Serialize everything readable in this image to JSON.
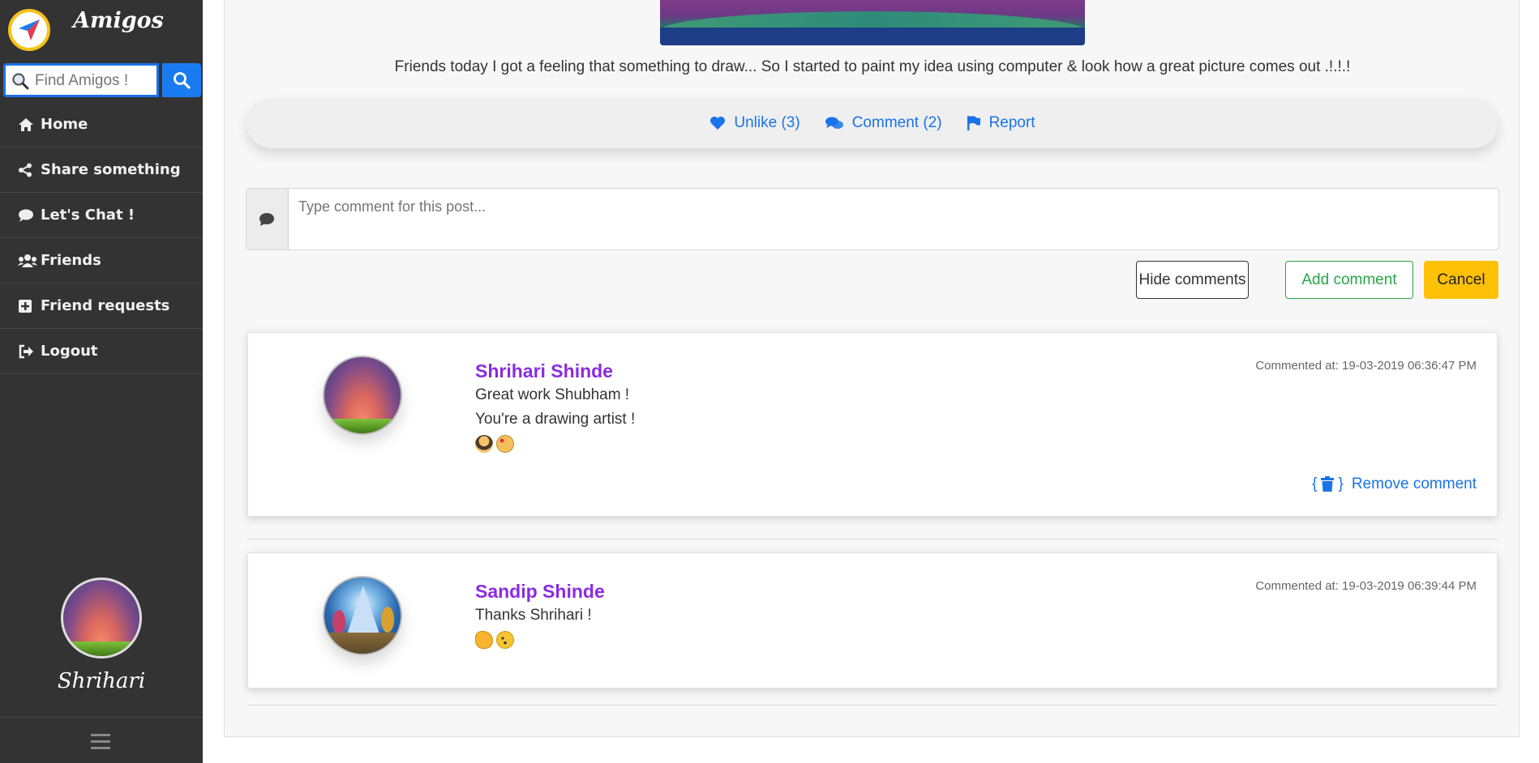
{
  "app": {
    "brand": "Amigos"
  },
  "search": {
    "placeholder": "Find Amigos !"
  },
  "nav": {
    "items": [
      {
        "label": "Home",
        "icon": "home-icon"
      },
      {
        "label": "Share something",
        "icon": "share-icon"
      },
      {
        "label": "Let's Chat !",
        "icon": "chat-icon"
      },
      {
        "label": "Friends",
        "icon": "users-icon"
      },
      {
        "label": "Friend requests",
        "icon": "plus-square-icon"
      },
      {
        "label": "Logout",
        "icon": "sign-out-icon"
      }
    ]
  },
  "user": {
    "name": "Shrihari"
  },
  "post": {
    "caption": "Friends today I got a feeling that something to draw... So I started to paint my idea using computer & look how a great picture comes out .!.!.!",
    "actions": {
      "unlike": "Unlike (3)",
      "comment": "Comment (2)",
      "report": "Report"
    }
  },
  "comment_form": {
    "placeholder": "Type comment for this post...",
    "hide_label": "Hide comments",
    "add_label": "Add comment",
    "cancel_label": "Cancel"
  },
  "comments": [
    {
      "author": "Shrihari Shinde",
      "time": "Commented at: 19-03-2019 06:36:47 PM",
      "lines": [
        "Great work Shubham !",
        "You're a drawing artist !"
      ],
      "emojis": [
        "artist-emoji",
        "palette-emoji"
      ],
      "remove_label": "Remove comment",
      "remove_prefix": "{",
      "remove_suffix": "}"
    },
    {
      "author": "Sandip Shinde",
      "time": "Commented at: 19-03-2019 06:39:44 PM",
      "lines": [
        "Thanks Shrihari !"
      ],
      "emojis": [
        "clapping-hands-emoji",
        "winking-face-emoji"
      ]
    }
  ],
  "colors": {
    "sidebar_bg": "#333333",
    "accent": "#1a73e8",
    "author": "#8a2be2",
    "success": "#28a745",
    "warning": "#ffc107"
  }
}
